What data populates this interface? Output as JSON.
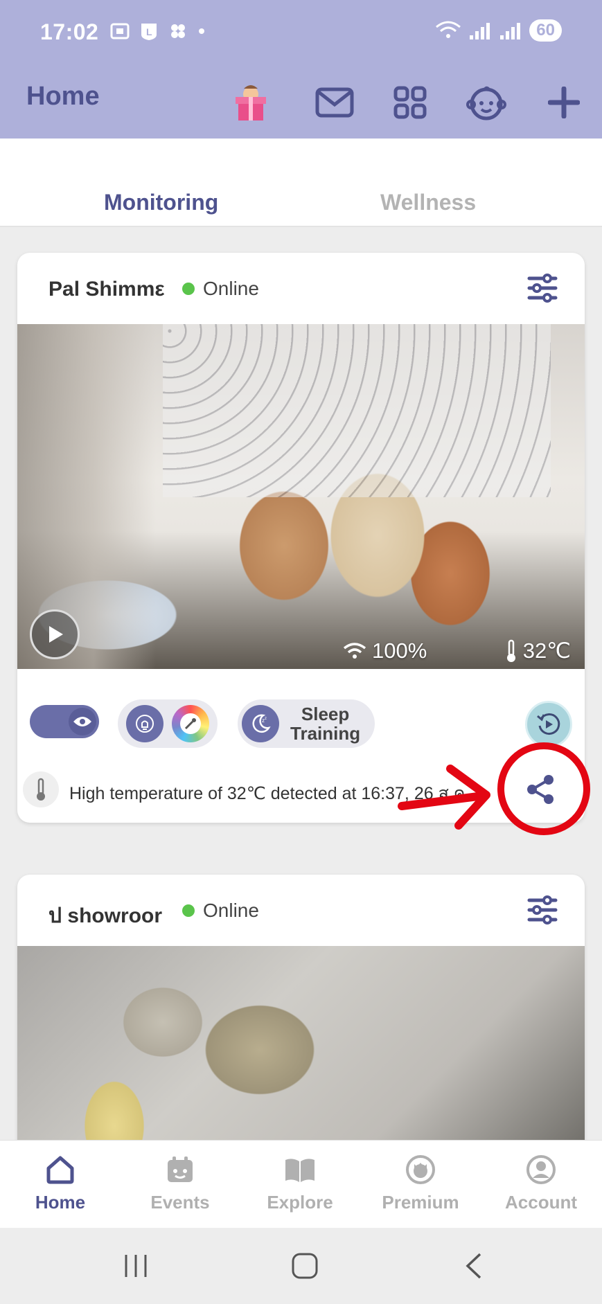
{
  "status_bar": {
    "time": "17:02",
    "battery": "60"
  },
  "header": {
    "title": "Home"
  },
  "tabs": [
    {
      "label": "Monitoring"
    },
    {
      "label": "Wellness"
    }
  ],
  "cameras": [
    {
      "name": "Pal Shimmε",
      "status": "Online",
      "wifi": "100%",
      "temperature": "32℃",
      "controls": {
        "sleep_training_line1": "Sleep",
        "sleep_training_line2": "Training"
      },
      "alert": "High temperature of 32℃ detected at 16:37, 26 ส.ค"
    },
    {
      "name": "ป showroor",
      "status": "Online"
    }
  ],
  "bottom_nav": [
    {
      "label": "Home"
    },
    {
      "label": "Events"
    },
    {
      "label": "Explore"
    },
    {
      "label": "Premium"
    },
    {
      "label": "Account"
    }
  ],
  "colors": {
    "header_bg": "#aeb0da",
    "accent": "#4e528e",
    "online": "#5ac44b",
    "annotation": "#e30613"
  }
}
